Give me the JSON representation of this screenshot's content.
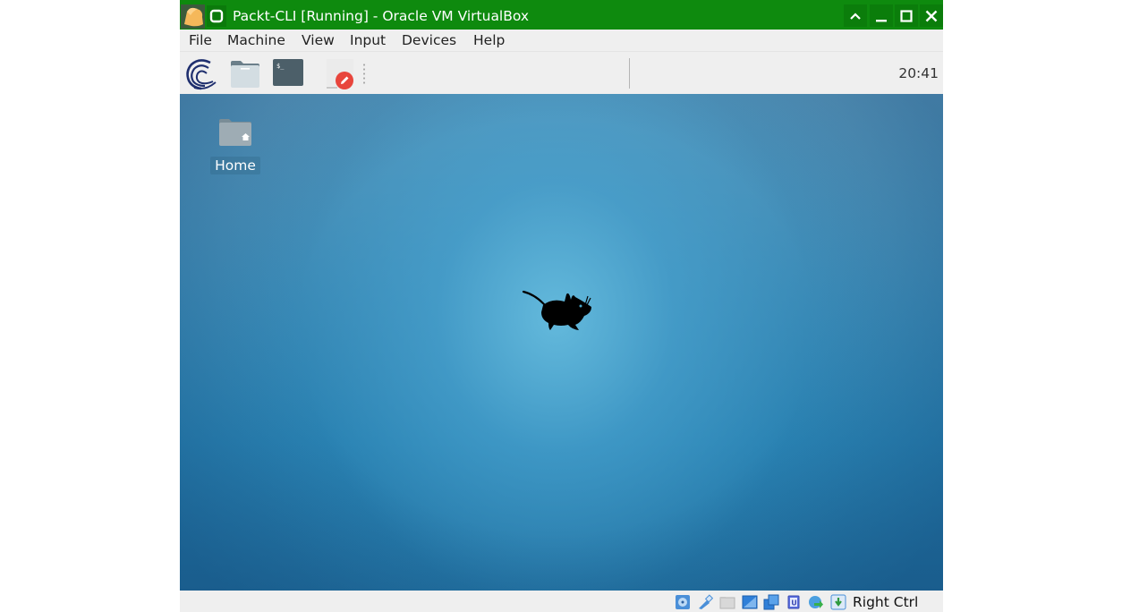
{
  "window": {
    "title": "Packt-CLI [Running] - Oracle VM VirtualBox",
    "titlebar_color": "#0e8a0e",
    "buttons": {
      "shade": "shade-button",
      "minimize": "minimize-button",
      "maximize": "maximize-button",
      "close": "close-button"
    }
  },
  "menubar": {
    "items": [
      {
        "label": "File"
      },
      {
        "label": "Machine"
      },
      {
        "label": "View"
      },
      {
        "label": "Input"
      },
      {
        "label": "Devices"
      },
      {
        "label": "Help"
      }
    ]
  },
  "panel": {
    "launchers": [
      {
        "icon": "applications-menu-icon"
      },
      {
        "icon": "file-manager-icon"
      },
      {
        "icon": "terminal-icon",
        "glyph": "$_"
      },
      {
        "icon": "notes-edit-icon"
      }
    ],
    "clock": "20:41"
  },
  "desktop": {
    "icons": [
      {
        "label": "Home",
        "icon": "home-folder-icon"
      }
    ],
    "wallpaper_logo": "xfce-mouse-logo"
  },
  "statusbar": {
    "indicators": [
      {
        "icon": "hard-disk-icon"
      },
      {
        "icon": "optical-drive-icon"
      },
      {
        "icon": "shared-folder-icon"
      },
      {
        "icon": "display-icon"
      },
      {
        "icon": "video-capture-icon"
      },
      {
        "icon": "cpu-icon",
        "glyph": "U"
      },
      {
        "icon": "network-icon"
      },
      {
        "icon": "mouse-integration-icon"
      }
    ],
    "host_key": "Right Ctrl"
  }
}
